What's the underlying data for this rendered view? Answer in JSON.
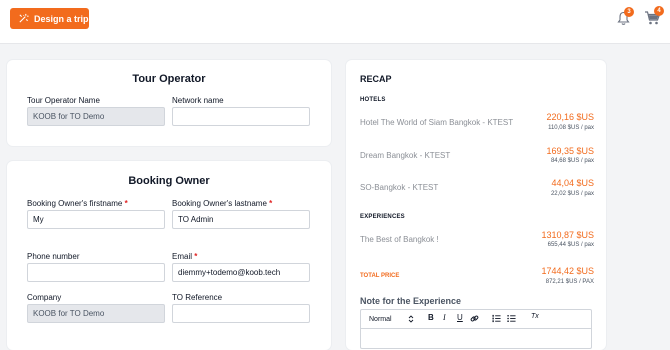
{
  "header": {
    "design_button_label": "Design a trip",
    "notifications_count": "3",
    "cart_count": "4"
  },
  "tour_operator": {
    "title": "Tour Operator",
    "name_label": "Tour Operator Name",
    "name_value": "KOOB for TO Demo",
    "network_label": "Network name",
    "network_value": ""
  },
  "booking_owner": {
    "title": "Booking Owner",
    "firstname_label": "Booking Owner's firstname",
    "firstname_value": "My",
    "lastname_label": "Booking Owner's lastname",
    "lastname_value": "TO Admin",
    "phone_label": "Phone number",
    "phone_value": "",
    "email_label": "Email",
    "email_value": "diemmy+todemo@koob.tech",
    "company_label": "Company",
    "company_value": "KOOB for TO Demo",
    "reference_label": "TO Reference",
    "reference_value": "",
    "required_mark": "*"
  },
  "recap": {
    "title": "RECAP",
    "hotels_heading": "HOTELS",
    "hotels": [
      {
        "name": "Hotel The World of Siam Bangkok - KTEST",
        "price": "220,16 $US",
        "per_pax": "110,08 $US / pax"
      },
      {
        "name": "Dream Bangkok - KTEST",
        "price": "169,35 $US",
        "per_pax": "84,68 $US / pax"
      },
      {
        "name": "SO-Bangkok - KTEST",
        "price": "44,04 $US",
        "per_pax": "22,02 $US / pax"
      }
    ],
    "experiences_heading": "EXPERIENCES",
    "experiences": [
      {
        "name": "The Best of Bangkok !",
        "price": "1310,87 $US",
        "per_pax": "655,44 $US / pax"
      }
    ],
    "total_label": "TOTAL PRICE",
    "total_price": "1744,42 $US",
    "total_per_pax": "872,21 $US / PAX",
    "note_title": "Note for the Experience",
    "editor": {
      "format_select": "Normal",
      "bold": "B",
      "italic": "I",
      "underline": "U",
      "clear": "Tx"
    }
  },
  "colors": {
    "accent": "#f26b1d",
    "required": "#e02424",
    "background": "#f3f4f6"
  },
  "icons": [
    "magic-wand-icon",
    "bell-icon",
    "cart-icon",
    "link-icon",
    "ordered-list-icon",
    "bullet-list-icon",
    "chevron-updown-icon"
  ]
}
